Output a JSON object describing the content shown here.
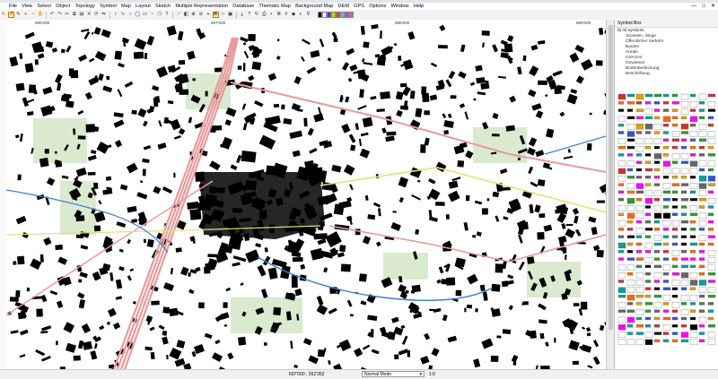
{
  "menu": [
    "File",
    "View",
    "Select",
    "Object",
    "Topology",
    "Symbol",
    "Map",
    "Layout",
    "Sketch",
    "Multiple Representation",
    "Database",
    "Thematic Map",
    "Background Map",
    "DEM",
    "GPS",
    "Options",
    "Window",
    "Help"
  ],
  "window_controls": {
    "minimize": "—",
    "maximize": "□",
    "close": "✕"
  },
  "map": {
    "coord_labels": [
      "696'000",
      "697'000",
      "698'000",
      "699'000"
    ]
  },
  "symbol_box": {
    "title": "Symbol Box",
    "root": "All symbols",
    "categories": [
      "Strassen, Wege",
      "Öffentlicher Verkehr",
      "Bauten",
      "Areale",
      "Grenzen",
      "Gewässer",
      "Bodenbedeckung",
      "Beschriftung"
    ]
  },
  "status": {
    "coords": "697'000 , 262'352",
    "mode": "Normal Mode",
    "zoom": "1:0",
    "mode_arrow": "▾"
  },
  "colors": {
    "rail": "#e89a9a",
    "road_yellow": "#e8e07a",
    "green": "#cfe5c2",
    "water": "#3a7fd0",
    "building": "#000000",
    "selected_tool": "#ffe6b3"
  }
}
